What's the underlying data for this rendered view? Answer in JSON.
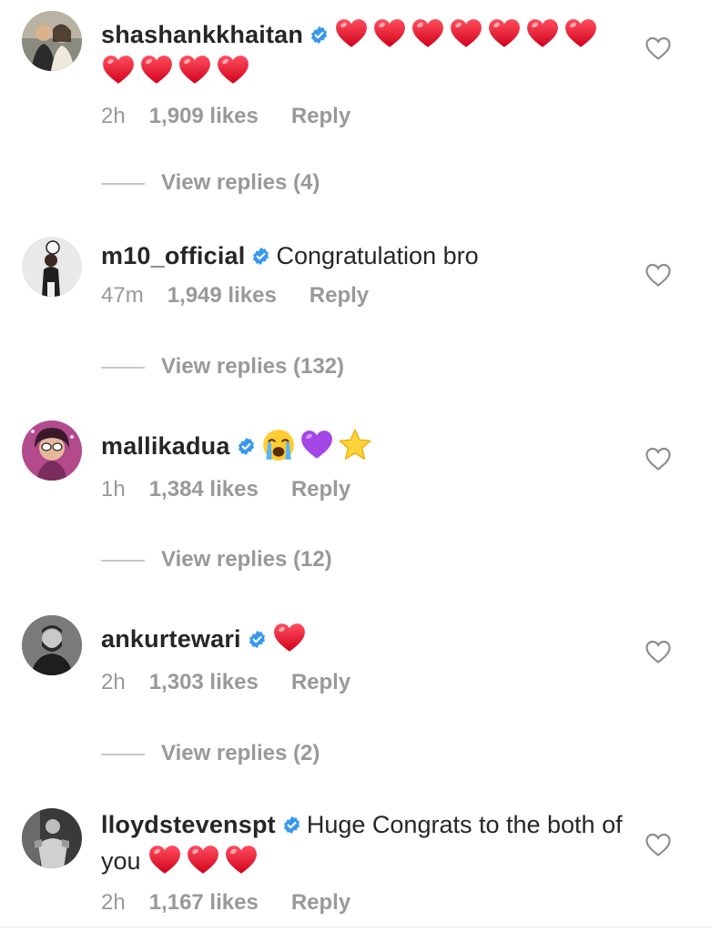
{
  "comments": [
    {
      "username": "shashankkhaitan",
      "text": "",
      "emojis": [
        "red-heart",
        "red-heart",
        "red-heart",
        "red-heart",
        "red-heart",
        "red-heart",
        "red-heart",
        "red-heart",
        "red-heart",
        "red-heart",
        "red-heart"
      ],
      "time": "2h",
      "likes": "1,909 likes",
      "reply": "Reply",
      "view_replies": "View replies (4)"
    },
    {
      "username": "m10_official",
      "text": "Congratulation bro",
      "emojis": [],
      "time": "47m",
      "likes": "1,949 likes",
      "reply": "Reply",
      "view_replies": "View replies (132)"
    },
    {
      "username": "mallikadua",
      "text": "",
      "emojis": [
        "crying-face",
        "purple-heart",
        "star"
      ],
      "time": "1h",
      "likes": "1,384 likes",
      "reply": "Reply",
      "view_replies": "View replies (12)"
    },
    {
      "username": "ankurtewari",
      "text": "",
      "emojis": [
        "red-heart"
      ],
      "time": "2h",
      "likes": "1,303 likes",
      "reply": "Reply",
      "view_replies": "View replies (2)"
    },
    {
      "username": "lloydstevenspt",
      "text": "Huge Congrats to the both of you",
      "emojis": [
        "red-heart",
        "red-heart",
        "red-heart"
      ],
      "time": "2h",
      "likes": "1,167 likes",
      "reply": "Reply",
      "view_replies": ""
    }
  ],
  "colors": {
    "text": "#262626",
    "muted": "#999999",
    "verified": "#3897f0",
    "heart_red": "#e8112d"
  }
}
